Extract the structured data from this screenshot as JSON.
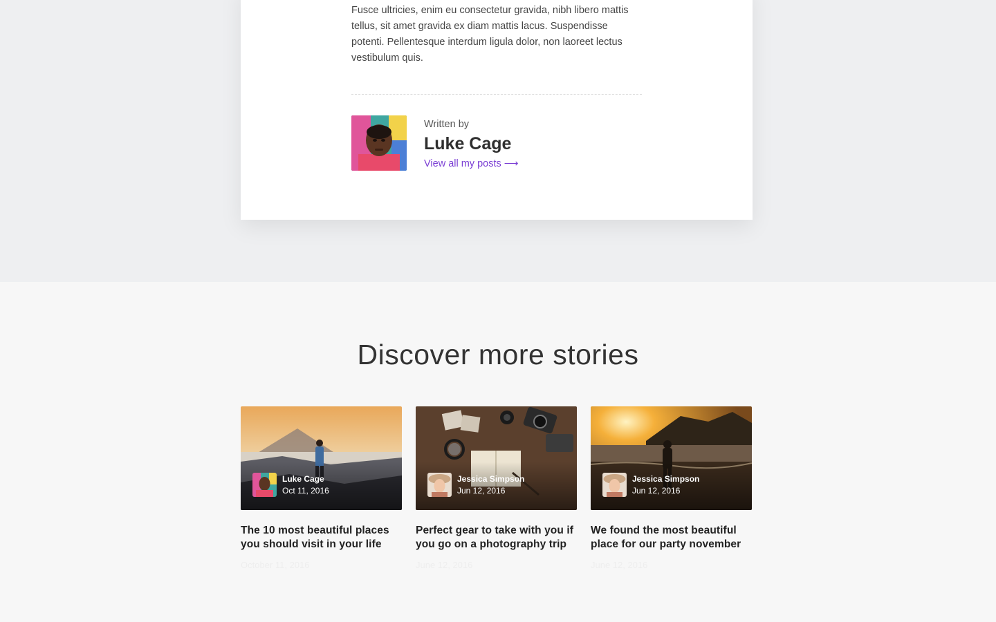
{
  "article": {
    "paragraph": "Fusce ultricies, enim eu consectetur gravida, nibh libero mattis tellus, sit amet gravida ex diam mattis lacus. Suspendisse potenti. Pellentesque interdum ligula dolor, non laoreet lectus vestibulum quis."
  },
  "author": {
    "written_by": "Written by",
    "name": "Luke Cage",
    "link": "View all my posts ⟶"
  },
  "discover": {
    "title": "Discover more stories",
    "stories": [
      {
        "author": "Luke Cage",
        "thumb_date": "Oct 11, 2016",
        "title": "The 10 most beautiful places you should visit in your life",
        "date": "October 11, 2016"
      },
      {
        "author": "Jessica Simpson",
        "thumb_date": "Jun 12, 2016",
        "title": "Perfect gear to take with you if you go on a photography trip",
        "date": "June 12, 2016"
      },
      {
        "author": "Jessica Simpson",
        "thumb_date": "Jun 12, 2016",
        "title": "We found the most beautiful place for our party november",
        "date": "June 12, 2016"
      }
    ]
  },
  "colors": {
    "accent": "#7b3fd4",
    "top_band": "#eeeff1",
    "page_bg": "#f7f7f7"
  }
}
